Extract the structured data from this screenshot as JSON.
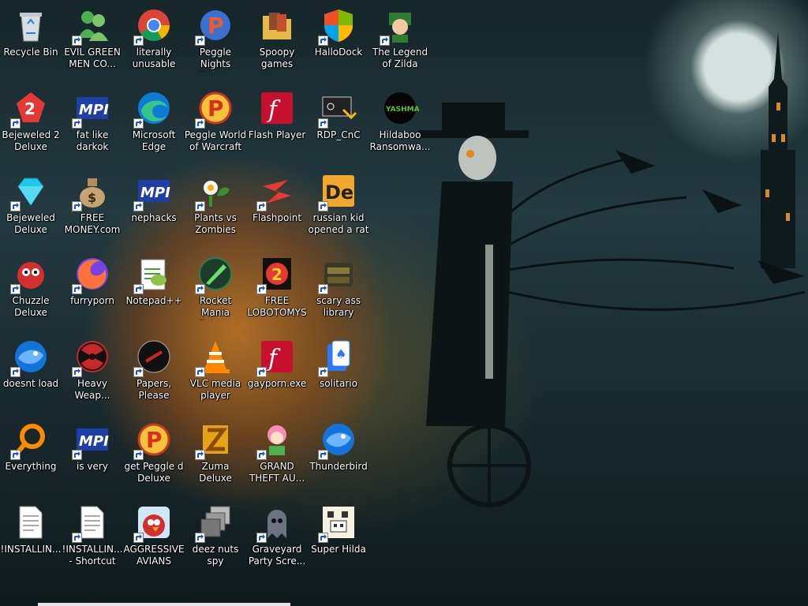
{
  "desktop": {
    "icons": [
      {
        "label": "Recycle Bin",
        "icon": "recycle-bin-icon",
        "shortcut": false
      },
      {
        "label": "EVIL GREEN MEN CO...",
        "icon": "messenger-icon",
        "shortcut": true
      },
      {
        "label": "literally unusable",
        "icon": "chrome-icon",
        "shortcut": true
      },
      {
        "label": "Peggle Nights Deluxe",
        "icon": "peggle-nights-icon",
        "shortcut": true
      },
      {
        "label": "Spoopy games",
        "icon": "folder-icon",
        "shortcut": false
      },
      {
        "label": "HalloDock",
        "icon": "shield-icon",
        "shortcut": true
      },
      {
        "label": "The Legend of Zilda",
        "icon": "zelda-icon",
        "shortcut": true
      },
      {
        "label": "Bejeweled 2 Deluxe",
        "icon": "bejeweled2-icon",
        "shortcut": true
      },
      {
        "label": "fat like darkok",
        "icon": "mpi-icon",
        "shortcut": true
      },
      {
        "label": "Microsoft Edge",
        "icon": "edge-icon",
        "shortcut": true
      },
      {
        "label": "Peggle World of Warcraft ...",
        "icon": "peggle-icon",
        "shortcut": true
      },
      {
        "label": "Flash Player",
        "icon": "flash-icon",
        "shortcut": false
      },
      {
        "label": "RDP_CnC",
        "icon": "rdp-icon",
        "shortcut": true
      },
      {
        "label": "Hildaboo Ransomwa...",
        "icon": "yashma-icon",
        "shortcut": false
      },
      {
        "label": "Bejeweled Deluxe",
        "icon": "diamond-icon",
        "shortcut": true
      },
      {
        "label": "FREE MONEY.com",
        "icon": "money-bag-icon",
        "shortcut": true
      },
      {
        "label": "nephacks",
        "icon": "mpi-icon",
        "shortcut": true
      },
      {
        "label": "Plants vs Zombies",
        "icon": "plants-icon",
        "shortcut": true
      },
      {
        "label": "Flashpoint",
        "icon": "flashpoint-icon",
        "shortcut": true
      },
      {
        "label": "russian kid opened a rat",
        "icon": "de-icon",
        "shortcut": true
      },
      {
        "label": "Chuzzle Deluxe",
        "icon": "chuzzle-icon",
        "shortcut": true
      },
      {
        "label": "furryporn",
        "icon": "firefox-icon",
        "shortcut": true
      },
      {
        "label": "Notepad++",
        "icon": "notepad-icon",
        "shortcut": true
      },
      {
        "label": "Rocket Mania Deluxe",
        "icon": "rocket-icon",
        "shortcut": true
      },
      {
        "label": "FREE LOBOTOMYS",
        "icon": "lobotomy-icon",
        "shortcut": true
      },
      {
        "label": "scary ass library",
        "icon": "library-icon",
        "shortcut": true
      },
      {
        "label": "doesnt load",
        "icon": "thunderbird-icon",
        "shortcut": true
      },
      {
        "label": "Heavy Weap...",
        "icon": "radiation-icon",
        "shortcut": true
      },
      {
        "label": "Papers, Please",
        "icon": "papers-please-icon",
        "shortcut": true
      },
      {
        "label": "VLC media player",
        "icon": "vlc-icon",
        "shortcut": true
      },
      {
        "label": "gayporn.exe",
        "icon": "flash-icon",
        "shortcut": true
      },
      {
        "label": "solitario",
        "icon": "solitaire-icon",
        "shortcut": true
      },
      {
        "label": "Everything",
        "icon": "search-icon",
        "shortcut": true
      },
      {
        "label": "is very",
        "icon": "mpi-icon",
        "shortcut": true
      },
      {
        "label": "get Peggle d Deluxe",
        "icon": "peggle-icon",
        "shortcut": true
      },
      {
        "label": "Zuma Deluxe",
        "icon": "zuma-icon",
        "shortcut": true
      },
      {
        "label": "GRAND THEFT AU...",
        "icon": "anime-girl-icon",
        "shortcut": true
      },
      {
        "label": "Thunderbird",
        "icon": "thunderbird-icon",
        "shortcut": true
      },
      {
        "label": "!INSTALLIN...",
        "icon": "document-icon",
        "shortcut": false
      },
      {
        "label": "!INSTALLIN... - Shortcut",
        "icon": "document-icon",
        "shortcut": true
      },
      {
        "label": "AGGRESSIVE AVIANS",
        "icon": "angry-bird-icon",
        "shortcut": true
      },
      {
        "label": "deez nuts spy",
        "icon": "windows-stack-icon",
        "shortcut": true
      },
      {
        "label": "Graveyard Party Scre...",
        "icon": "ghost-icon",
        "shortcut": true
      },
      {
        "label": "Super Hilda",
        "icon": "pixel-cat-icon",
        "shortcut": true
      }
    ]
  }
}
